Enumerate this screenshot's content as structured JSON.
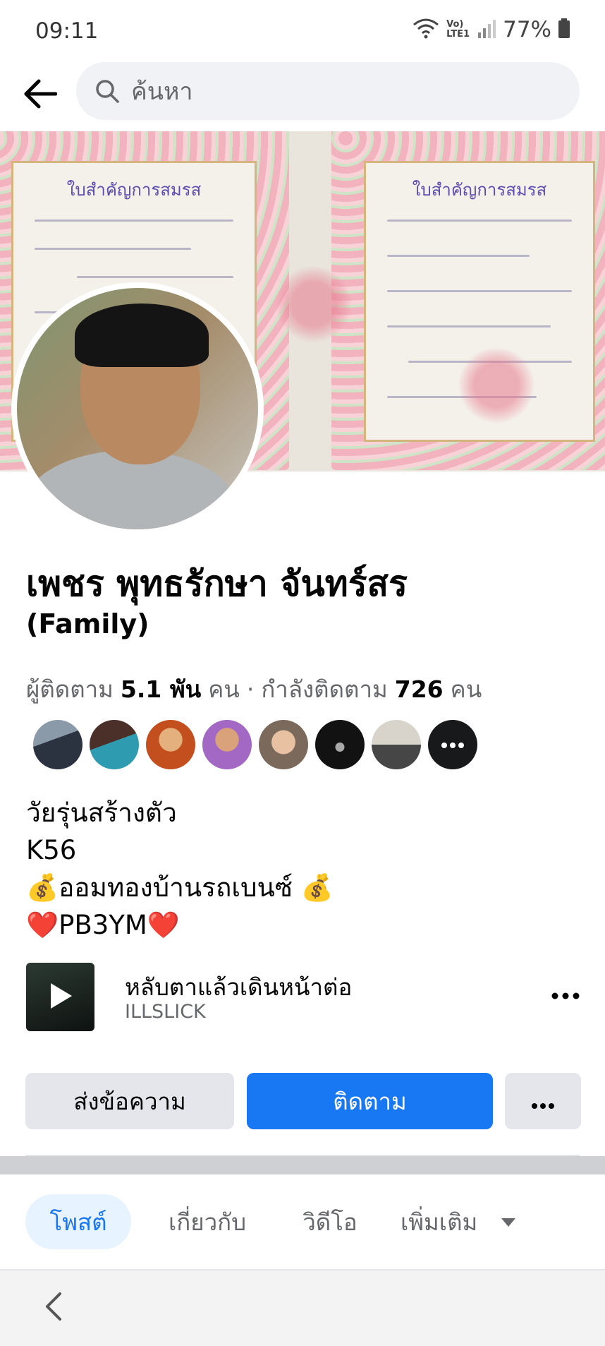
{
  "status_bar": {
    "time": "09:11",
    "network_label": "Vo) LTE1",
    "battery": "77%"
  },
  "search": {
    "placeholder": "ค้นหา"
  },
  "profile": {
    "name": "เพชร พุทธรักษา จันทร์สร",
    "subname": "(Family)",
    "followers_label": "ผู้ติดตาม",
    "followers_count": "5.1 พัน",
    "followers_unit": "คน",
    "separator": "·",
    "following_label": "กำลังติดตาม",
    "following_count": "726",
    "following_unit": "คน"
  },
  "cover": {
    "certificate_title": "ใบสำคัญการสมรส"
  },
  "bio": {
    "lines": [
      "วัยรุ่นสร้างตัว",
      "K56",
      "💰ออมทองบ้านรถเบนซ์ 💰",
      "❤️PB3YM❤️"
    ]
  },
  "music": {
    "title": "หลับตาแล้วเดินหน้าต่อ",
    "artist": "ILLSLICK"
  },
  "actions": {
    "message_label": "ส่งข้อความ",
    "follow_label": "ติดตาม"
  },
  "tabs": {
    "items": [
      "โพสต์",
      "เกี่ยวกับ",
      "วิดีโอ",
      "เพิ่มเติม"
    ]
  },
  "colors": {
    "accent": "#1877f2",
    "tab_active_bg": "#e7f3ff",
    "secondary_button": "#e4e6eb",
    "muted_text": "#65676b"
  },
  "icons": {
    "back": "arrow-left-icon",
    "search": "search-icon",
    "more": "more-dots-icon",
    "play": "play-icon",
    "dropdown": "caret-down-icon",
    "nav_back": "chevron-left-icon"
  }
}
